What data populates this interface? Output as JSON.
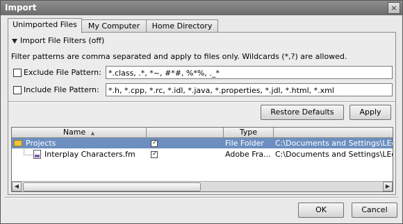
{
  "window": {
    "title": "Import",
    "close_glyph": "×"
  },
  "tabs": [
    {
      "label": "Unimported Files",
      "active": true
    },
    {
      "label": "My Computer",
      "active": false
    },
    {
      "label": "Home Directory",
      "active": false
    }
  ],
  "filters": {
    "header": "Import File Filters (off)",
    "description": "Filter patterns are comma separated and apply to files only. Wildcards (*,?) are allowed.",
    "exclude_label": "Exclude File Pattern:",
    "exclude_value": "*.class, .*, *~, #*#, %*%, ._*",
    "exclude_checked": false,
    "include_label": "Include File Pattern:",
    "include_value": "*.h, *.cpp, *.rc, *.idl, *.java, *.properties, *.jdl, *.html, *.xml",
    "include_checked": false
  },
  "buttons": {
    "restore_defaults": "Restore Defaults",
    "apply": "Apply",
    "ok": "OK",
    "cancel": "Cancel"
  },
  "table": {
    "columns": [
      "Name",
      "",
      "Type",
      ""
    ],
    "sort_indicator": "▲",
    "rows": [
      {
        "name": "Projects",
        "checked": true,
        "type": "File Folder",
        "path": "C:\\Documents and Settings\\LEdv",
        "selected": true,
        "icon": "folder-icon"
      },
      {
        "name": "Interplay Characters.fm",
        "checked": true,
        "type": "Adobe Fra...",
        "path": "C:\\Documents and Settings\\LEdv",
        "selected": false,
        "icon": "document-icon"
      }
    ]
  },
  "colors": {
    "selection": "#6d8fc0",
    "titlebar": "#7a7a7a"
  }
}
